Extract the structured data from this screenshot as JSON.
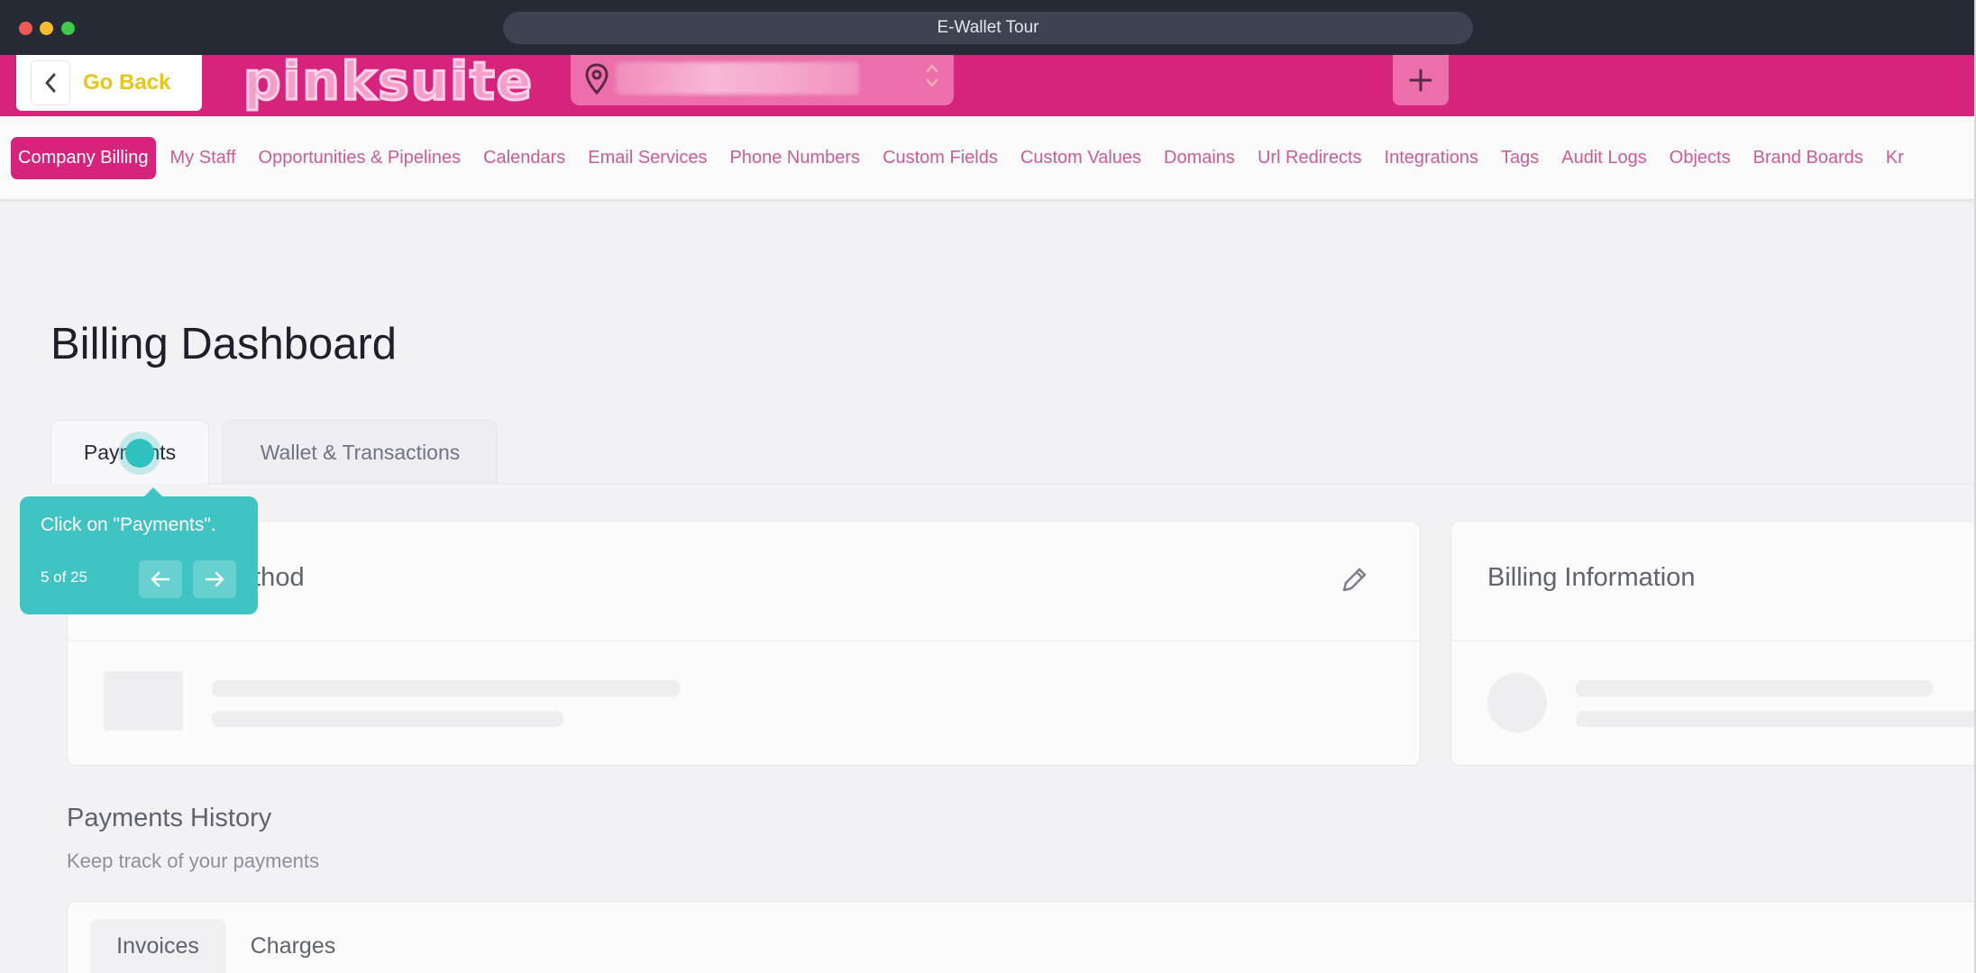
{
  "window": {
    "title": "E-Wallet Tour"
  },
  "header": {
    "go_back_label": "Go Back",
    "logo_text": "pinksuite",
    "colors": {
      "brand": "#d6247c",
      "go_back": "#e8c51c",
      "accent": "#3fc3c3"
    }
  },
  "nav": {
    "items": [
      {
        "label": "Company Billing",
        "active": true
      },
      {
        "label": "My Staff"
      },
      {
        "label": "Opportunities & Pipelines"
      },
      {
        "label": "Calendars"
      },
      {
        "label": "Email Services"
      },
      {
        "label": "Phone Numbers"
      },
      {
        "label": "Custom Fields"
      },
      {
        "label": "Custom Values"
      },
      {
        "label": "Domains"
      },
      {
        "label": "Url Redirects"
      },
      {
        "label": "Integrations"
      },
      {
        "label": "Tags"
      },
      {
        "label": "Audit Logs"
      },
      {
        "label": "Objects"
      },
      {
        "label": "Brand Boards"
      },
      {
        "label": "Kr"
      }
    ]
  },
  "page": {
    "title": "Billing Dashboard",
    "tabs": [
      {
        "label": "Payments",
        "active": true
      },
      {
        "label": "Wallet & Transactions"
      }
    ],
    "method_card_title": "ethod",
    "billing_card_title": "Billing Information",
    "history": {
      "title": "Payments History",
      "subtitle": "Keep track of your payments",
      "tabs": [
        {
          "label": "Invoices",
          "active": true
        },
        {
          "label": "Charges"
        }
      ]
    }
  },
  "tour": {
    "message": "Click on \"Payments\".",
    "step": "5 of 25"
  }
}
